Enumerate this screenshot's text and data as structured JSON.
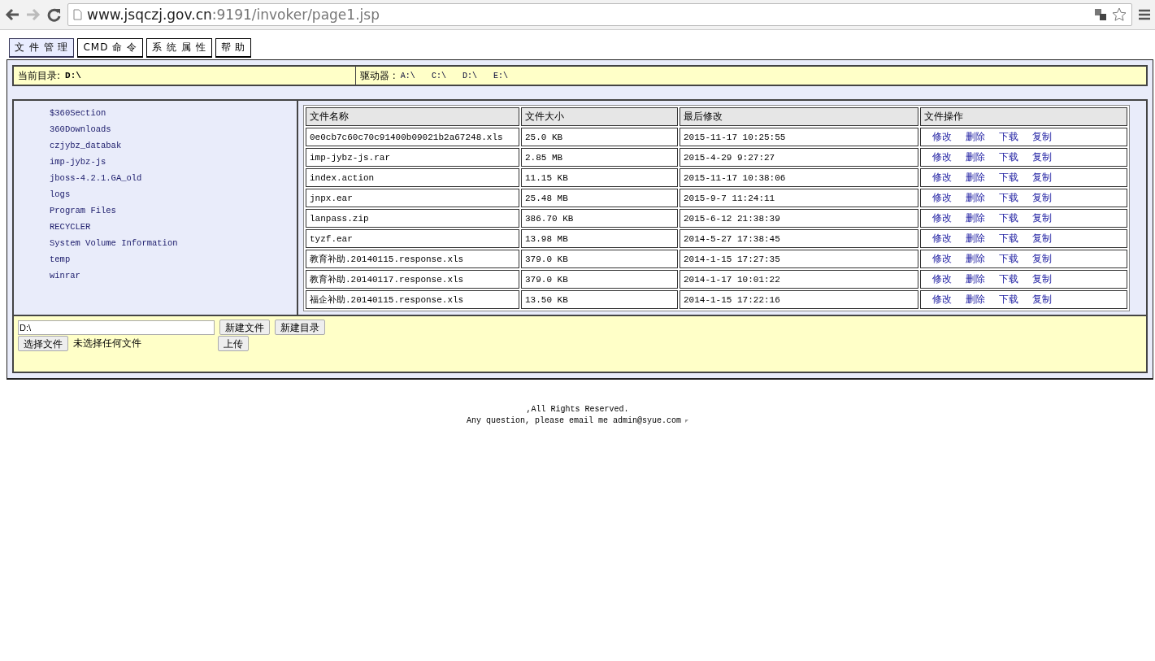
{
  "browser": {
    "url_host": "www.jsqczj.gov.cn",
    "url_path": ":9191/invoker/page1.jsp"
  },
  "tabs": [
    {
      "label": "文 件 管 理",
      "selected": true
    },
    {
      "label": "CMD 命 令",
      "selected": false
    },
    {
      "label": "系 统 属 性",
      "selected": false
    },
    {
      "label": "帮 助",
      "selected": false
    }
  ],
  "location": {
    "label": "当前目录:",
    "path": "D:\\",
    "drives_label": "驱动器 :",
    "drives": [
      "A:\\",
      "C:\\",
      "D:\\",
      "E:\\"
    ]
  },
  "folders": [
    "$360Section",
    "360Downloads",
    "czjybz_databak",
    "imp-jybz-js",
    "jboss-4.2.1.GA_old",
    "logs",
    "Program Files",
    "RECYCLER",
    "System Volume Information",
    "temp",
    "winrar"
  ],
  "table": {
    "columns": [
      "文件名称",
      "文件大小",
      "最后修改",
      "文件操作"
    ],
    "rows": [
      {
        "name": "0e0cb7c60c70c91400b09021b2a67248.xls",
        "size": "25.0 KB",
        "modified": "2015-11-17 10:25:55",
        "actions": [
          "修改",
          "删除",
          "下载",
          "复制"
        ]
      },
      {
        "name": "imp-jybz-js.rar",
        "size": "2.85 MB",
        "modified": "2015-4-29 9:27:27",
        "actions": [
          "修改",
          "删除",
          "下载",
          "复制"
        ]
      },
      {
        "name": "index.action",
        "size": "11.15 KB",
        "modified": "2015-11-17 10:38:06",
        "actions": [
          "修改",
          "删除",
          "下载",
          "复制"
        ]
      },
      {
        "name": "jnpx.ear",
        "size": "25.48 MB",
        "modified": "2015-9-7 11:24:11",
        "actions": [
          "修改",
          "删除",
          "下载",
          "复制"
        ]
      },
      {
        "name": "lanpass.zip",
        "size": "386.70 KB",
        "modified": "2015-6-12 21:38:39",
        "actions": [
          "修改",
          "删除",
          "下载",
          "复制"
        ]
      },
      {
        "name": "tyzf.ear",
        "size": "13.98 MB",
        "modified": "2014-5-27 17:38:45",
        "actions": [
          "修改",
          "删除",
          "下载",
          "复制"
        ]
      },
      {
        "name": "教育补助.20140115.response.xls",
        "size": "379.0 KB",
        "modified": "2014-1-15 17:27:35",
        "actions": [
          "修改",
          "删除",
          "下载",
          "复制"
        ]
      },
      {
        "name": "教育补助.20140117.response.xls",
        "size": "379.0 KB",
        "modified": "2014-1-17 10:01:22",
        "actions": [
          "修改",
          "删除",
          "下载",
          "复制"
        ]
      },
      {
        "name": "福企补助.20140115.response.xls",
        "size": "13.50 KB",
        "modified": "2014-1-15 17:22:16",
        "actions": [
          "修改",
          "删除",
          "下载",
          "复制"
        ]
      }
    ]
  },
  "bottom": {
    "path_value": "D:\\",
    "new_file": "新建文件",
    "new_dir": "新建目录",
    "choose_file": "选择文件",
    "no_file": "未选择任何文件",
    "upload": "上传"
  },
  "footer": {
    "rights": ",All Rights Reserved.",
    "contact": "Any question, please email me admin@syue.com"
  }
}
